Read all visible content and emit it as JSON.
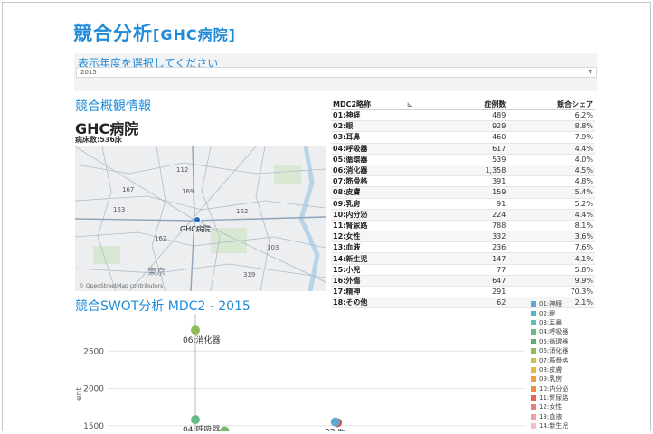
{
  "header": {
    "title": "競合分析",
    "subtitle": "[GHC病院]"
  },
  "filter": {
    "label": "表示年度を選択してください",
    "selected": "2015"
  },
  "overview": {
    "section_title": "競合概観情報",
    "hospital_name": "GHC病院",
    "beds": "病床数:536床",
    "map": {
      "pin_label": "GHC病院",
      "credit": "© OpenStreetMap contributors",
      "place_label": "東京",
      "route_labels": [
        "112",
        "167",
        "169",
        "162",
        "153",
        "162",
        "103",
        "319"
      ]
    }
  },
  "mdc_table": {
    "headers": {
      "name": "MDC2略称",
      "cases": "症例数",
      "share": "競合シェア"
    },
    "rows": [
      {
        "name": "01:神経",
        "cases": "489",
        "share": "6.2%"
      },
      {
        "name": "02:眼",
        "cases": "929",
        "share": "8.8%"
      },
      {
        "name": "03:耳鼻",
        "cases": "460",
        "share": "7.9%"
      },
      {
        "name": "04:呼吸器",
        "cases": "617",
        "share": "4.4%"
      },
      {
        "name": "05:循環器",
        "cases": "539",
        "share": "4.0%"
      },
      {
        "name": "06:消化器",
        "cases": "1,358",
        "share": "4.5%"
      },
      {
        "name": "07:筋骨格",
        "cases": "391",
        "share": "4.8%"
      },
      {
        "name": "08:皮膚",
        "cases": "159",
        "share": "5.4%"
      },
      {
        "name": "09:乳房",
        "cases": "91",
        "share": "5.2%"
      },
      {
        "name": "10:内分泌",
        "cases": "224",
        "share": "4.4%"
      },
      {
        "name": "11:腎尿路",
        "cases": "788",
        "share": "8.1%"
      },
      {
        "name": "12:女性",
        "cases": "332",
        "share": "3.6%"
      },
      {
        "name": "13:血液",
        "cases": "236",
        "share": "7.6%"
      },
      {
        "name": "14:新生児",
        "cases": "147",
        "share": "4.1%"
      },
      {
        "name": "15:小児",
        "cases": "77",
        "share": "5.8%"
      },
      {
        "name": "16:外傷",
        "cases": "647",
        "share": "9.9%"
      },
      {
        "name": "17:精神",
        "cases": "291",
        "share": "70.3%"
      },
      {
        "name": "18:その他",
        "cases": "62",
        "share": "2.1%"
      }
    ]
  },
  "swot": {
    "section_title": "競合SWOT分析 MDC2 - 2015",
    "y_axis_label_fragment": "ent"
  },
  "chart_data": {
    "type": "scatter",
    "title": "競合SWOT分析 MDC2 - 2015",
    "ylim": [
      1400,
      3000
    ],
    "yticks": [
      1500,
      2000,
      2500
    ],
    "points": [
      {
        "label": "06:消化器",
        "x": 0.21,
        "y": 2780,
        "color": "#8fba5a"
      },
      {
        "label": "04:呼吸器",
        "x": 0.21,
        "y": 1580,
        "color": "#67b98a"
      },
      {
        "label": "",
        "x": 0.28,
        "y": 1430,
        "color": "#7bb86a"
      },
      {
        "label": "02:眼",
        "x": 0.55,
        "y": 1540,
        "color": "#d05a5a"
      },
      {
        "label": "",
        "x": 0.545,
        "y": 1550,
        "color": "#5fa9d0"
      }
    ],
    "grid": true
  },
  "legend": [
    {
      "label": "01:神経",
      "color": "#5fa9d0"
    },
    {
      "label": "02:眼",
      "color": "#4fb8c8"
    },
    {
      "label": "03:耳鼻",
      "color": "#5cc0b8"
    },
    {
      "label": "04:呼吸器",
      "color": "#67b98a"
    },
    {
      "label": "05:循環器",
      "color": "#5cae6e"
    },
    {
      "label": "06:消化器",
      "color": "#8fba5a"
    },
    {
      "label": "07:筋骨格",
      "color": "#c9c24a"
    },
    {
      "label": "08:皮膚",
      "color": "#e8b840"
    },
    {
      "label": "09:乳房",
      "color": "#f0a040"
    },
    {
      "label": "10:内分泌",
      "color": "#f08a4a"
    },
    {
      "label": "11:腎尿路",
      "color": "#e06a5a"
    },
    {
      "label": "12:女性",
      "color": "#e8807a"
    },
    {
      "label": "13:血液",
      "color": "#f0a0a8"
    },
    {
      "label": "14:新生児",
      "color": "#f4c0c8"
    }
  ]
}
